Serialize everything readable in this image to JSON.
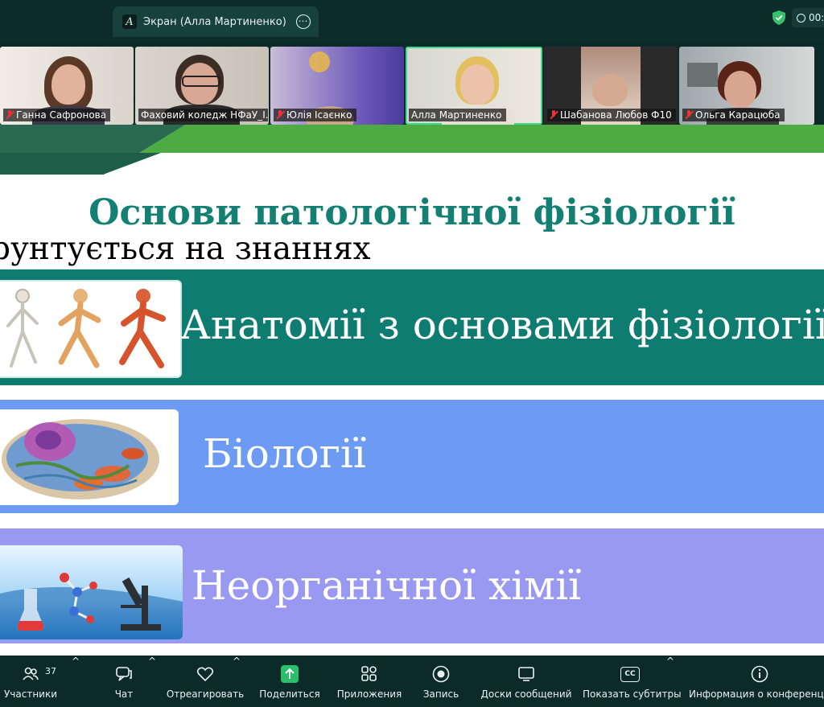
{
  "topbar": {
    "share_title": "Экран (Алла Мартиненко)",
    "logo_letter": "A",
    "timer_text": "00:",
    "more_glyph": "•••"
  },
  "participants": [
    {
      "name": "Ганна Сафронова",
      "muted": true
    },
    {
      "name": "Фаховий коледж НФаУ_І...",
      "muted": false
    },
    {
      "name": "Юлія Ісаєнко",
      "muted": true
    },
    {
      "name": "Алла Мартиненко",
      "muted": false,
      "active": true
    },
    {
      "name": "Шабанова Любов Ф10",
      "muted": true
    },
    {
      "name": "Ольга Карацюба",
      "muted": true
    }
  ],
  "slide": {
    "title": "Основи патологічної фізіології",
    "subtitle": "рунтується на знаннях",
    "items": [
      {
        "label": "Анатомії з основами фізіології"
      },
      {
        "label": "Біології"
      },
      {
        "label": "Неорганічної хімії"
      }
    ],
    "colors": {
      "teal": "#0f7c72",
      "blue": "#6d9af2",
      "violet": "#9a99f2",
      "title": "#138073",
      "green_band": "#4eaa43"
    }
  },
  "toolbar": {
    "participants_label": "Участники",
    "participants_count": "37",
    "chat_label": "Чат",
    "react_label": "Отреагировать",
    "share_label": "Поделиться",
    "apps_label": "Приложения",
    "record_label": "Запись",
    "whiteboards_label": "Доски сообщений",
    "captions_label": "Показать субтитры",
    "cc_text": "CC",
    "info_label": "Информация о конференции",
    "caret": "^"
  }
}
